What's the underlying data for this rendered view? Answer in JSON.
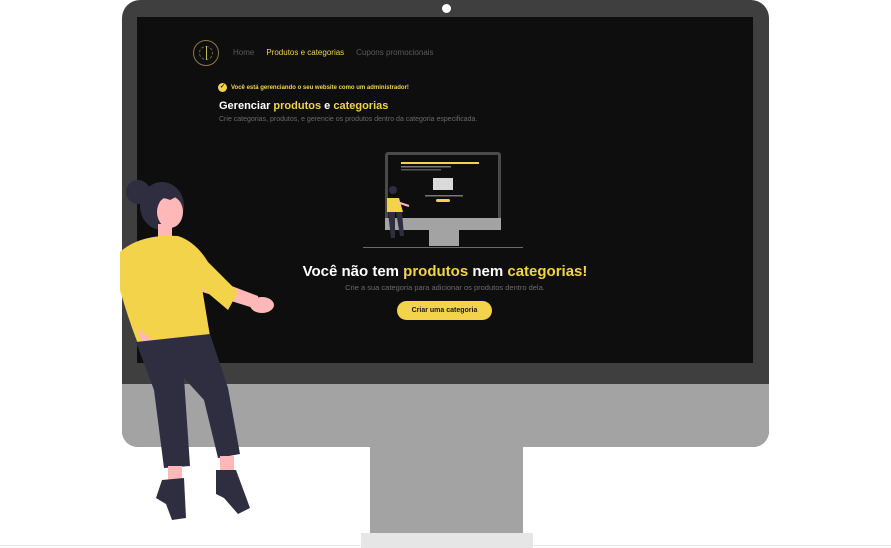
{
  "nav": {
    "items": [
      {
        "label": "Home",
        "active": false
      },
      {
        "label": "Produtos e categorias",
        "active": true
      },
      {
        "label": "Cupons promocionais",
        "active": false
      }
    ]
  },
  "admin_note": "Você está gerenciando o seu website como um administrador!",
  "heading": {
    "prefix": "Gerenciar ",
    "highlight_1": "produtos",
    "middle": " e ",
    "highlight_2": "categorias"
  },
  "subheading": "Crie categorias, produtos, e gerencie os produtos dentro da categoria especificada.",
  "empty_state": {
    "title_prefix": "Você não tem ",
    "title_highlight_1": "produtos",
    "title_middle": " nem ",
    "title_highlight_2": "categorias!",
    "subtitle": "Crie a sua categoria para adicionar os produtos dentro dela.",
    "cta_label": "Criar uma categoria"
  },
  "colors": {
    "accent": "#f2d34a",
    "screen_bg": "#0e0e0e",
    "bezel": "#3f3f3f",
    "chin": "#a3a3a3",
    "person_shirt": "#f2d34a",
    "person_pants": "#2f2e41",
    "person_skin": "#ffb8b8"
  }
}
